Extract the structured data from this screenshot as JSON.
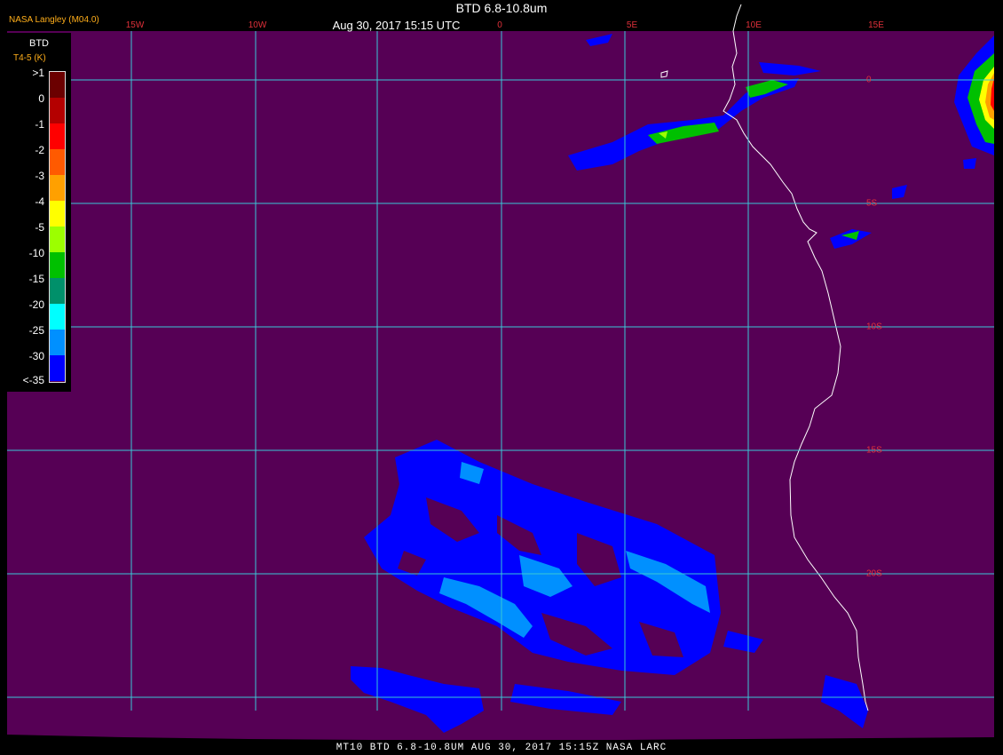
{
  "credit": "NASA Langley (M04.0)",
  "title": "BTD 6.8-10.8um",
  "timestamp": "Aug 30, 2017 15:15 UTC",
  "footer": "MT10  BTD 6.8-10.8UM  AUG 30, 2017 15:15Z  NASA LARC",
  "colors": {
    "background": "#560055",
    "grid": "#39c9d6",
    "coast": "#ffffff",
    "label": "#e0303a",
    "credit": "#ffae1a"
  },
  "longitude_labels": [
    "15W",
    "10W",
    "0",
    "5E",
    "10E",
    "15E"
  ],
  "latitude_labels": [
    "0",
    "5S",
    "10S",
    "15S",
    "20S"
  ],
  "legend": {
    "title": "BTD",
    "units": "T4-5 (K)",
    "ticks": [
      ">1",
      "0",
      "-1",
      "-2",
      "-3",
      "-4",
      "-5",
      "-10",
      "-15",
      "-20",
      "-25",
      "-30",
      "<-35"
    ],
    "colors": [
      "#6b0000",
      "#b40000",
      "#ff0000",
      "#ff5a00",
      "#ffa000",
      "#ffff00",
      "#9cff00",
      "#00c000",
      "#00906a",
      "#00ffff",
      "#0090ff",
      "#0000ff",
      "#560055"
    ]
  },
  "features": [
    {
      "name": "coastline",
      "type": "line"
    },
    {
      "name": "cloud-band-north",
      "type": "area",
      "btd_range": "-25 to -3"
    },
    {
      "name": "cloud-mass-northeast",
      "type": "area",
      "btd_range": "-10 to >1"
    },
    {
      "name": "cloud-area-south",
      "type": "area",
      "btd_range": "-30 to -20"
    }
  ]
}
